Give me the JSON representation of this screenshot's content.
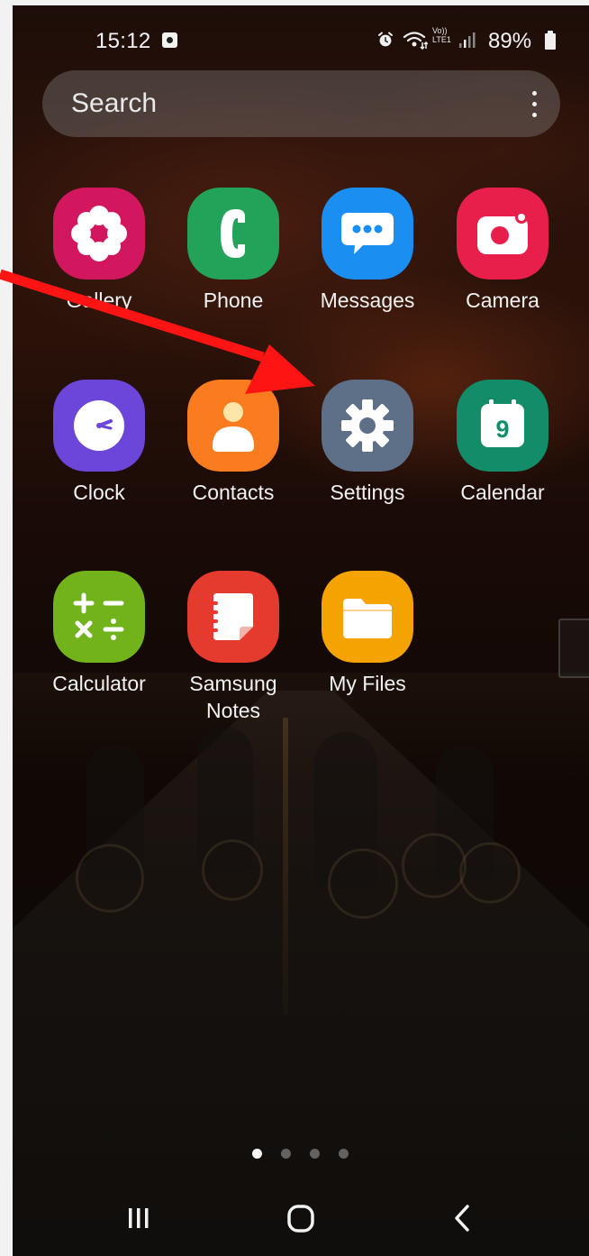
{
  "status_bar": {
    "time": "15:12",
    "volte": "Vo))",
    "lte": "LTE1",
    "battery_percent": "89%",
    "icons": [
      "notification-icon",
      "alarm-icon",
      "wifi-icon",
      "signal-icon",
      "battery-icon"
    ]
  },
  "search": {
    "placeholder": "Search",
    "menu_icon": "more-vertical-icon"
  },
  "apps": [
    {
      "label": "Gallery",
      "icon": "gallery-icon",
      "color": "#d2175f"
    },
    {
      "label": "Phone",
      "icon": "phone-icon",
      "color": "#23a35a"
    },
    {
      "label": "Messages",
      "icon": "messages-icon",
      "color": "#1b8ef2"
    },
    {
      "label": "Camera",
      "icon": "camera-icon",
      "color": "#e81e4b"
    },
    {
      "label": "Clock",
      "icon": "clock-icon",
      "color": "#6b46d9"
    },
    {
      "label": "Contacts",
      "icon": "contacts-icon",
      "color": "#fb7c1f"
    },
    {
      "label": "Settings",
      "icon": "settings-icon",
      "color": "#5d7088"
    },
    {
      "label": "Calendar",
      "icon": "calendar-icon",
      "color": "#128c69",
      "calendar_day": "9"
    },
    {
      "label": "Calculator",
      "icon": "calculator-icon",
      "color": "#72b21b"
    },
    {
      "label": "Samsung\nNotes",
      "icon": "notes-icon",
      "color": "#e53a2e"
    },
    {
      "label": "My Files",
      "icon": "my-files-icon",
      "color": "#f5a300"
    }
  ],
  "annotation": {
    "arrow_color": "#ff1010",
    "points_to": "Settings"
  },
  "page_indicator": {
    "total": 4,
    "active": 1
  },
  "nav_bar": {
    "buttons": [
      "recent-apps-icon",
      "home-icon",
      "back-icon"
    ]
  }
}
